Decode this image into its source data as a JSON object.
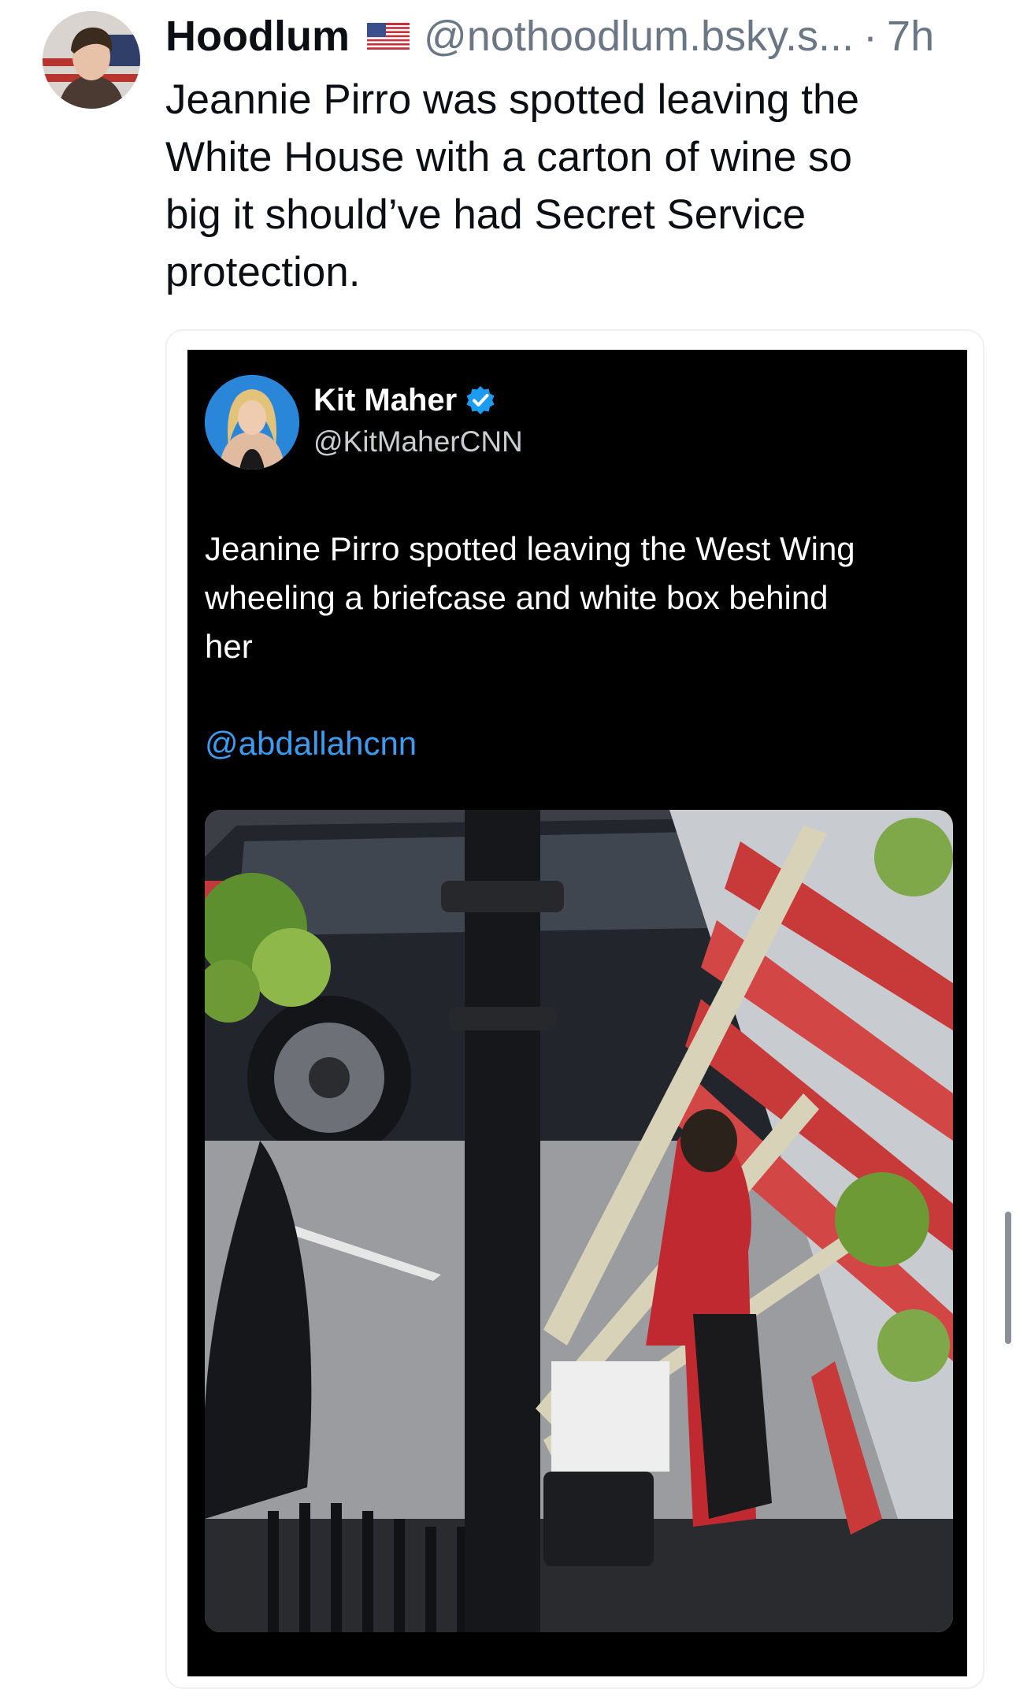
{
  "post": {
    "author_name": "Hoodlum",
    "flag_icon": "us-flag-icon",
    "handle": "@nothoodlum.bsky.s...",
    "separator": "·",
    "time": "7h",
    "text": "Jeannie Pirro was spotted leaving the\nWhite House with a carton of wine so\nbig it should’ve had Secret Service\nprotection."
  },
  "quoted": {
    "name": "Kit Maher",
    "verified_icon": "verified-badge-icon",
    "handle": "@KitMaherCNN",
    "text": "Jeanine Pirro spotted leaving the West Wing\nwheeling a briefcase and white box behind\nher",
    "mention": "@abdallahcnn"
  },
  "colors": {
    "handle_gray": "#6b7784",
    "mention_blue": "#3d9bf0",
    "verified_blue": "#1d9bf0",
    "embed_background": "#000000"
  }
}
